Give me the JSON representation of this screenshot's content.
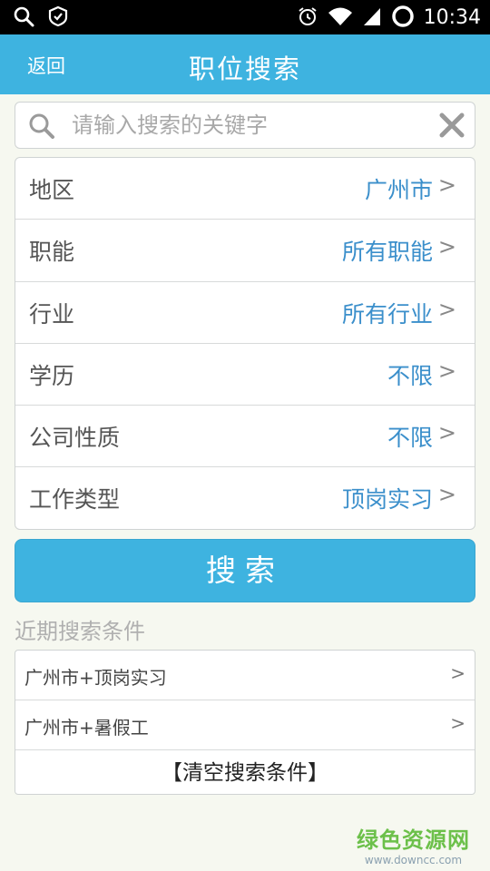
{
  "status_bar": {
    "time": "10:34"
  },
  "header": {
    "back_label": "返回",
    "title": "职位搜索"
  },
  "search": {
    "placeholder": "请输入搜索的关键字",
    "value": ""
  },
  "filters": [
    {
      "label": "地区",
      "value": "广州市"
    },
    {
      "label": "职能",
      "value": "所有职能"
    },
    {
      "label": "行业",
      "value": "所有行业"
    },
    {
      "label": "学历",
      "value": "不限"
    },
    {
      "label": "公司性质",
      "value": "不限"
    },
    {
      "label": "工作类型",
      "value": "顶岗实习"
    }
  ],
  "chevron": ">",
  "search_button_label": "搜索",
  "recent": {
    "title": "近期搜索条件",
    "items": [
      {
        "label": "广州市+顶岗实习"
      },
      {
        "label": "广州市+暑假工"
      }
    ],
    "clear_label": "【清空搜索条件】"
  },
  "watermark": {
    "main": "绿色资源网",
    "sub": "www.downcc.com"
  },
  "colors": {
    "accent": "#3eb3e0",
    "value_text": "#3b8fcb",
    "watermark_green": "#6cc04a"
  }
}
